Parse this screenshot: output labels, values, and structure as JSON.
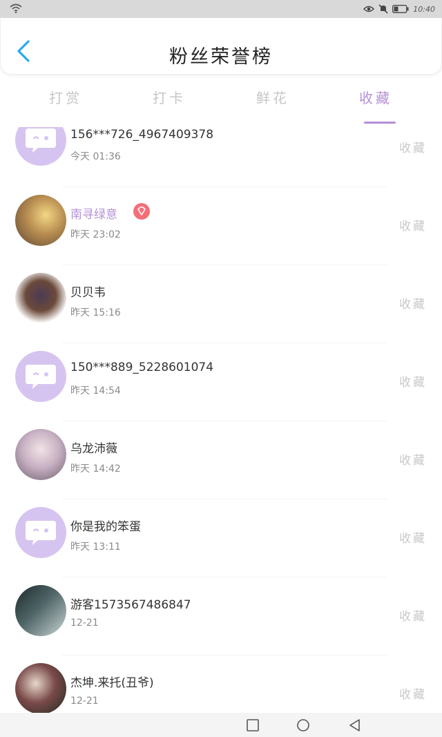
{
  "status_bar": {
    "time": "10:40",
    "icons": [
      "wifi-icon",
      "eye-icon",
      "mute-icon",
      "battery-icon"
    ]
  },
  "header": {
    "title": "粉丝荣誉榜",
    "back_icon": "chevron-left-icon"
  },
  "tabs": [
    {
      "label": "打赏",
      "active": false
    },
    {
      "label": "打卡",
      "active": false
    },
    {
      "label": "鲜花",
      "active": false
    },
    {
      "label": "收藏",
      "active": true
    }
  ],
  "colors": {
    "accent": "#b48fd6",
    "avatar_default": "#d6c4f0",
    "vip_badge": "#f36f78"
  },
  "list": [
    {
      "name": "156***726_4967409378",
      "time": "今天 01:36",
      "action": "收藏",
      "avatar": "default-chat-avatar",
      "vip": false
    },
    {
      "name": "南寻绿意",
      "time": "昨天 23:02",
      "action": "收藏",
      "avatar": "user-photo-avatar",
      "vip": true
    },
    {
      "name": "贝贝韦",
      "time": "昨天 15:16",
      "action": "收藏",
      "avatar": "user-photo-avatar",
      "vip": false
    },
    {
      "name": "150***889_5228601074",
      "time": "昨天 14:54",
      "action": "收藏",
      "avatar": "default-chat-avatar",
      "vip": false
    },
    {
      "name": "乌龙沛薇",
      "time": "昨天 14:42",
      "action": "收藏",
      "avatar": "user-photo-avatar",
      "vip": false
    },
    {
      "name": "你是我的笨蛋",
      "time": "昨天 13:11",
      "action": "收藏",
      "avatar": "default-chat-avatar",
      "vip": false
    },
    {
      "name": "游客1573567486847",
      "time": "12-21",
      "action": "收藏",
      "avatar": "user-photo-avatar",
      "vip": false
    },
    {
      "name": "杰坤.来托(丑爷)",
      "time": "12-21",
      "action": "收藏",
      "avatar": "user-photo-avatar",
      "vip": false
    }
  ],
  "navbar": {
    "icons": [
      "recent-apps-icon",
      "home-icon",
      "back-icon"
    ]
  }
}
